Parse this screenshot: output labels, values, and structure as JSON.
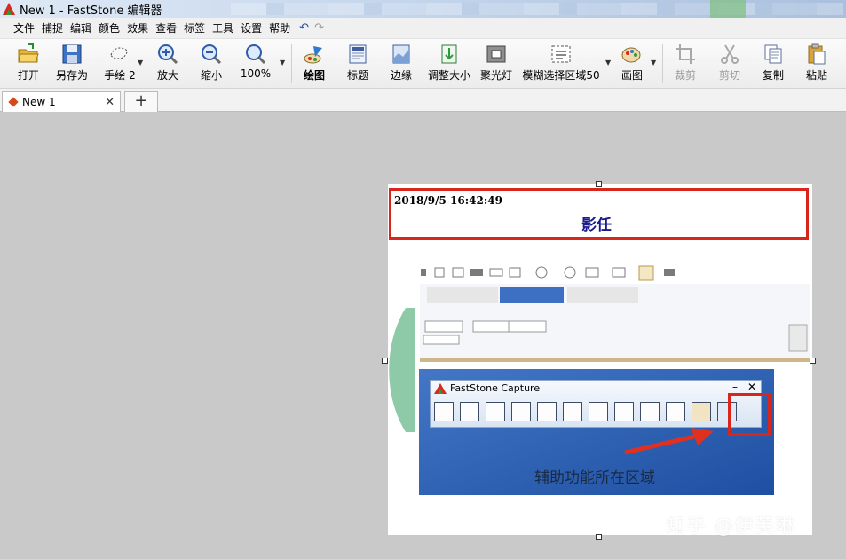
{
  "window": {
    "title": "New 1 - FastStone 编辑器"
  },
  "menu": {
    "items": [
      "文件",
      "捕捉",
      "编辑",
      "颜色",
      "效果",
      "查看",
      "标签",
      "工具",
      "设置",
      "帮助"
    ],
    "undo_glyph": "↶",
    "redo_glyph": "↷"
  },
  "toolbar": {
    "open": "打开",
    "save_as": "另存为",
    "freehand": "手绘 2",
    "zoom_in": "放大",
    "zoom_out": "缩小",
    "zoom_level": "100%",
    "draw": "绘图",
    "caption": "标题",
    "edge": "边缘",
    "resize": "调整大小",
    "spotlight": "聚光灯",
    "blur": "模糊选择区域50",
    "paint": "画图",
    "crop": "裁剪",
    "cut": "剪切",
    "copy": "复制",
    "paste": "粘贴"
  },
  "tabs": {
    "doc_name": "New 1",
    "close_glyph": "✕",
    "add_glyph": "+"
  },
  "image": {
    "timestamp": "2018/9/5 16:42:49",
    "caption": "影任",
    "faststone_title": "FastStone Capture",
    "min_glyph": "–",
    "close_glyph": "✕",
    "aux_label": "辅助功能所在区域"
  },
  "watermark": "知乎 @伊芙琳",
  "colors": {
    "highlight_red": "#d9261c",
    "caption_blue": "#1a1a8a",
    "capture_bg": "#2d5fb0"
  }
}
